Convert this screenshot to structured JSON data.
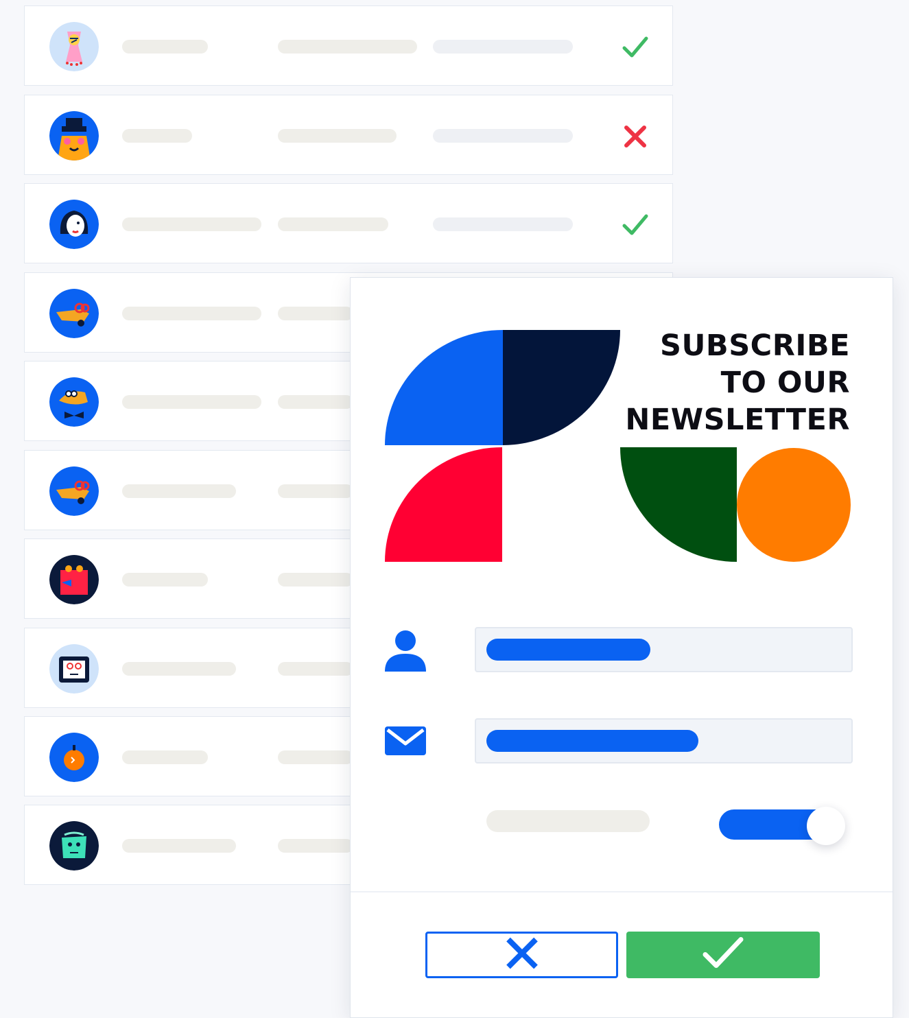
{
  "list": {
    "rows": [
      {
        "avatar": "avatar-pink-figure",
        "status": "check-icon"
      },
      {
        "avatar": "avatar-hat-face",
        "status": "cross-icon"
      },
      {
        "avatar": "avatar-girl-face",
        "status": "check-icon"
      },
      {
        "avatar": "avatar-dog-glasses",
        "status": ""
      },
      {
        "avatar": "avatar-duck-bowtie",
        "status": ""
      },
      {
        "avatar": "avatar-dog-glasses",
        "status": ""
      },
      {
        "avatar": "avatar-red-robot",
        "status": ""
      },
      {
        "avatar": "avatar-tv-face",
        "status": ""
      },
      {
        "avatar": "avatar-pumpkin",
        "status": ""
      },
      {
        "avatar": "avatar-teal-face",
        "status": ""
      }
    ]
  },
  "modal": {
    "title_lines": [
      "SUBSCRIBE",
      "TO OUR",
      "NEWSLETTER"
    ],
    "name_field_icon": "user-icon",
    "email_field_icon": "mail-icon",
    "toggle_on": true,
    "cancel_icon": "close-icon",
    "confirm_icon": "check-icon"
  },
  "colors": {
    "accent_blue": "#0a62f2",
    "success_green": "#3fba64",
    "error_red": "#ee3344",
    "art_navy": "#03153a",
    "art_red": "#ff0033",
    "art_green": "#004f10",
    "art_orange": "#ff7c00"
  }
}
